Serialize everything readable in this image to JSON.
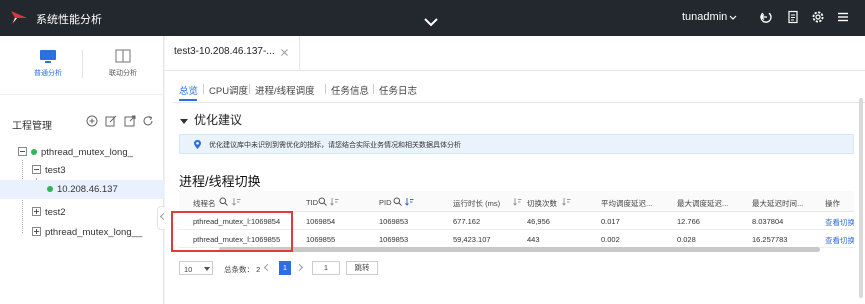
{
  "header": {
    "app_title": "系统性能分析",
    "username": "tunadmin",
    "colors": {
      "bar": "#23282e",
      "accent": "#2d6ee0",
      "logo_red": "#d9363e"
    },
    "icons": [
      "collapse-chevron-icon",
      "user-caret-icon",
      "logout-icon",
      "document-icon",
      "gear-icon",
      "menu-icon"
    ]
  },
  "sidebar": {
    "modes": [
      {
        "label": "普通分析",
        "icon": "monitor-icon",
        "active": true
      },
      {
        "label": "联动分析",
        "icon": "split-view-icon",
        "active": false
      }
    ],
    "project_title": "工程管理",
    "project_tools": [
      "add-circle-icon",
      "edit-icon",
      "export-icon",
      "refresh-icon"
    ],
    "tree": [
      {
        "label": "pthread_mutex_long_",
        "status": "green"
      },
      {
        "label": "test3"
      },
      {
        "label": "10.208.46.137",
        "status": "green",
        "selected": true
      },
      {
        "label": "test2"
      },
      {
        "label": "pthread_mutex_long__"
      }
    ]
  },
  "main": {
    "doc_tab": "test3-10.208.46.137-...",
    "subtabs": [
      "总览",
      "CPU调度",
      "进程/线程调度",
      "任务信息",
      "任务日志"
    ],
    "active_subtab": 0,
    "optimization": {
      "title": "优化建议",
      "notice": "优化建议库中未识别到需优化的指标，请您结合实际业务情况和相关数据具体分析"
    },
    "switch_section": {
      "title": "进程/线程切换",
      "columns": [
        "线程名",
        "TID",
        "PID",
        "运行时长 (ms)",
        "切换次数",
        "平均调度延迟...",
        "最大调度延迟...",
        "最大延迟时间...",
        "操作"
      ],
      "rows": [
        [
          "pthread_mutex_l:1069854",
          "1069854",
          "1069853",
          "677.162",
          "46,956",
          "0.017",
          "12.766",
          "8.037804",
          "查看切换"
        ],
        [
          "pthread_mutex_l:1069855",
          "1069855",
          "1069853",
          "59,423.107",
          "443",
          "0.002",
          "0.028",
          "16.257783",
          "查看切换"
        ]
      ]
    },
    "pagination": {
      "page_size": "10",
      "total": "总条数： 2",
      "current_page": "1",
      "jump_value": "1",
      "jump_label": "跳转"
    }
  }
}
